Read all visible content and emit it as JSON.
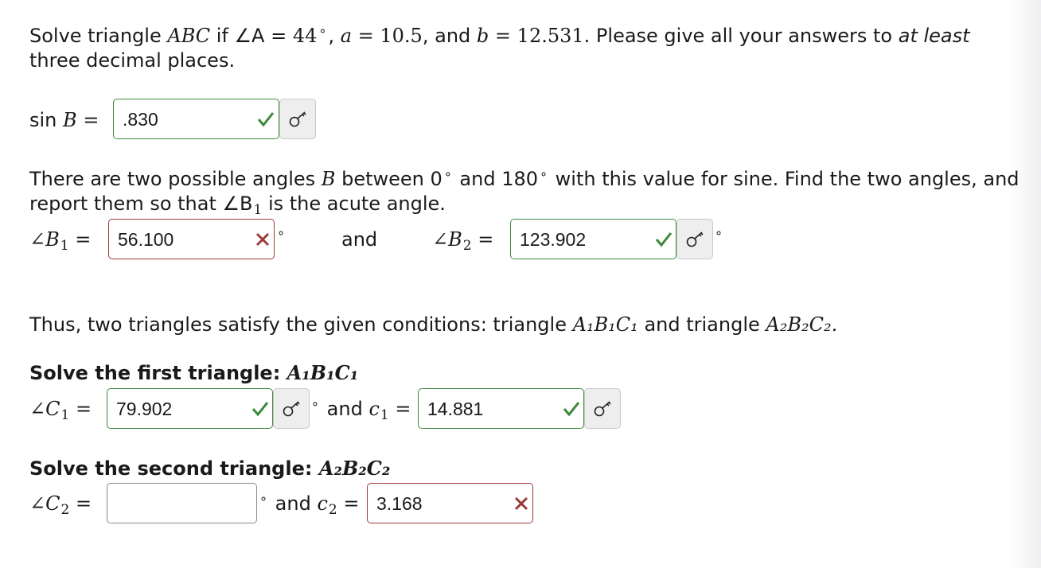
{
  "problem": {
    "lead": "Solve triangle",
    "triangle": "ABC",
    "given_a_label": "if ∠A =",
    "angle_a": "44",
    "comma": ",",
    "a_var": "a",
    "a_value": "10.5",
    "and_word": "and",
    "b_var": "b",
    "b_value": "12.531",
    "instruction": "Please give all your answers to",
    "emphasis": "at least",
    "instruction_end": "three decimal places."
  },
  "sinB": {
    "label_sin": "sin",
    "label_var": "B",
    "value": ".830"
  },
  "two_angles": {
    "text1": "There are two possible angles",
    "var": "B",
    "text2": "between 0",
    "text3": "and 180",
    "text4": "with this value for sine. Find the two angles, and",
    "text5": "report them so that ∠B",
    "sub": "1",
    "text6": "is the acute angle."
  },
  "B1": {
    "label": "∠B",
    "sub": "1",
    "value": "56.100"
  },
  "B2": {
    "label": "∠B",
    "sub": "2",
    "value": "123.902"
  },
  "between_and": "and",
  "thus": {
    "text1": "Thus, two triangles satisfy the given conditions: triangle",
    "tri1": "A₁B₁C₁",
    "text2": "and triangle",
    "tri2": "A₂B₂C₂."
  },
  "first": {
    "heading": "Solve the first triangle:",
    "tri": "A₁B₁C₁",
    "angle_label": "∠C",
    "angle_sub": "1",
    "angle_value": "79.902",
    "and_word": "and",
    "side_label": "c",
    "side_sub": "1",
    "side_value": "14.881"
  },
  "second": {
    "heading": "Solve the second triangle:",
    "tri": "A₂B₂C₂",
    "angle_label": "∠C",
    "angle_sub": "2",
    "angle_value": "",
    "and_word": "and",
    "side_label": "c",
    "side_sub": "2",
    "side_value": "3.168"
  },
  "symbols": {
    "equals": "=",
    "degree": "∘"
  },
  "colors": {
    "correct": "#3c8a3c",
    "incorrect": "#a03a3a"
  },
  "icons": {
    "correct": "checkmark-icon",
    "incorrect": "x-mark-icon",
    "answer_key": "key-icon"
  }
}
